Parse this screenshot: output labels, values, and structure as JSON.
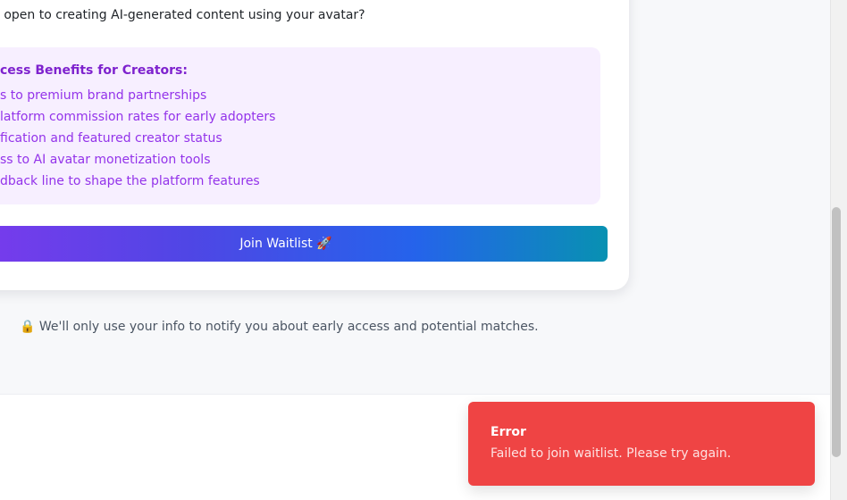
{
  "form": {
    "question": "u open to creating AI-generated content using your avatar?",
    "benefits_title": "cess Benefits for Creators:",
    "benefits": [
      "s to premium brand partnerships",
      "latform commission rates for early adopters",
      "fication and featured creator status",
      "ss to AI avatar monetization tools",
      "dback line to shape the platform features"
    ],
    "join_button_label": "Join Waitlist 🚀"
  },
  "privacy_note": "🔒 We'll only use your info to notify you about early access and potential matches.",
  "toast": {
    "title": "Error",
    "message": "Failed to join waitlist. Please try again."
  },
  "colors": {
    "benefits_bg": "#f7efff",
    "benefits_text": "#9333ea",
    "button_gradient_start": "#7c3aed",
    "button_gradient_end": "#0891b2",
    "toast_bg": "#ef4444"
  }
}
